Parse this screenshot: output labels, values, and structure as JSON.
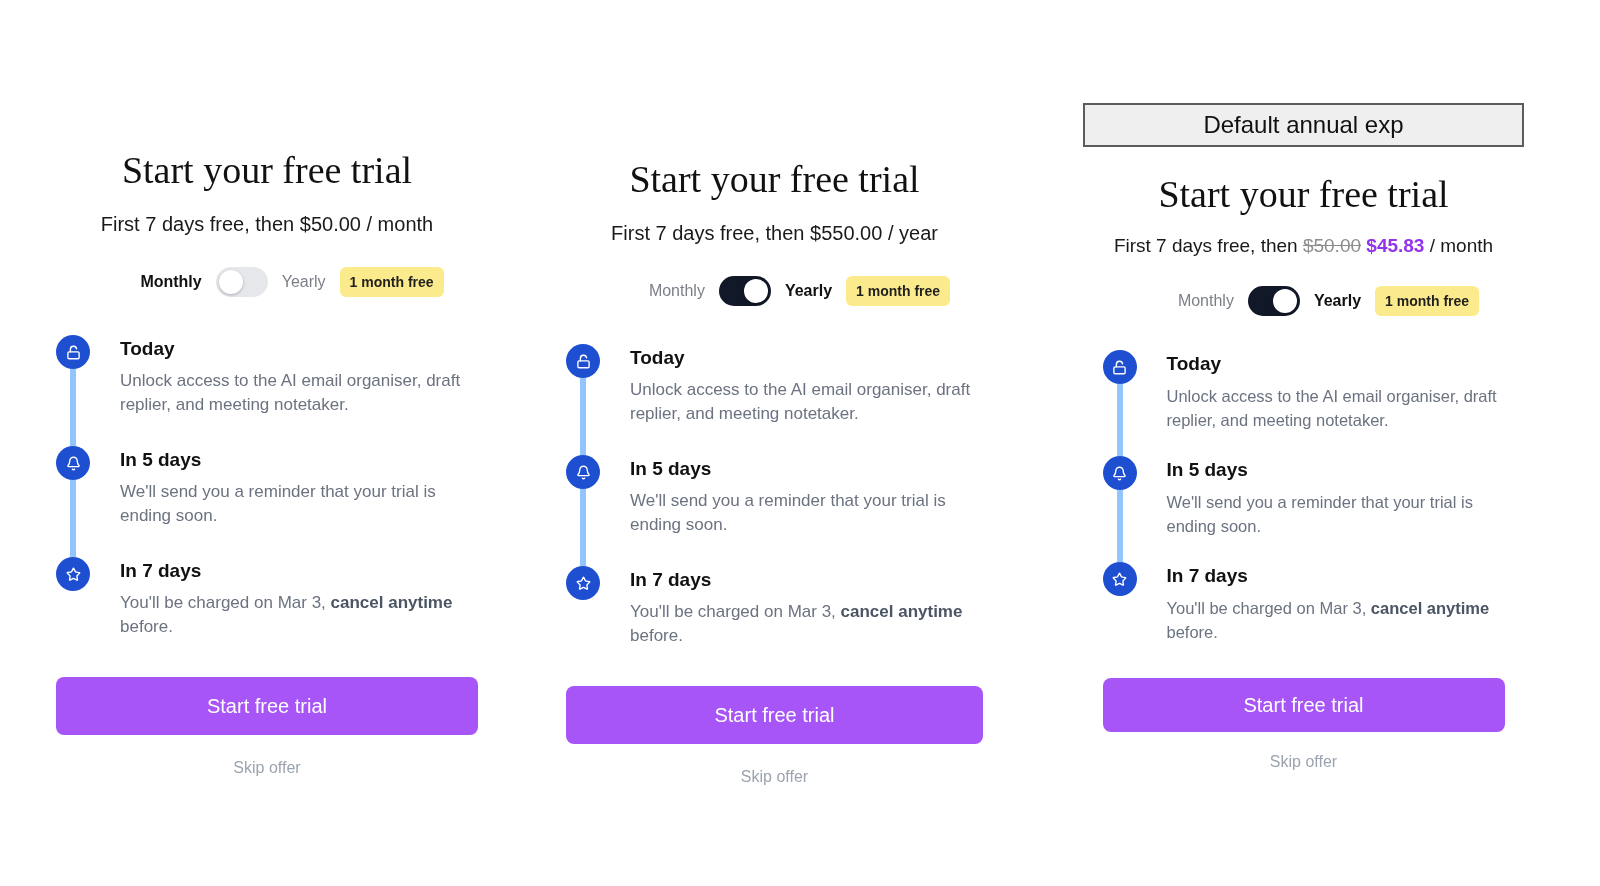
{
  "panels": [
    {
      "title": "Start your free trial",
      "offer": {
        "lead": "First 7 days free, then",
        "price": "$50.00",
        "period": "/ month"
      },
      "billing": {
        "options": [
          {
            "label": "Monthly",
            "selected": true
          },
          {
            "label": "Yearly",
            "selected": false
          }
        ],
        "switch_on": false,
        "badge": "1 month free"
      },
      "steps": [
        {
          "title": "Today",
          "text": "Unlock access to the AI email organiser, draft replier, and meeting notetaker."
        },
        {
          "title": "In 5 days",
          "text": "We'll send you a reminder that your trial is ending soon."
        },
        {
          "title": "In 7 days",
          "text": "You'll be charged on Mar 3, **cancel anytime** before."
        }
      ],
      "cta": "Start free trial",
      "skip": "Skip offer"
    },
    {
      "title": "Start your free trial",
      "offer": {
        "lead": "First 7 days free, then",
        "price": "$550.00",
        "period": "/ year"
      },
      "billing": {
        "options": [
          {
            "label": "Monthly",
            "selected": false
          },
          {
            "label": "Yearly",
            "selected": true
          }
        ],
        "switch_on": true,
        "badge": "1 month free"
      },
      "steps": [
        {
          "title": "Today",
          "text": "Unlock access to the AI email organiser, draft replier, and meeting notetaker."
        },
        {
          "title": "In 5 days",
          "text": "We'll send you a reminder that your trial is ending soon."
        },
        {
          "title": "In 7 days",
          "text": "You'll be charged on Mar 3, **cancel anytime** before."
        }
      ],
      "cta": "Start free trial",
      "skip": "Skip offer"
    },
    {
      "banner": "Default annual exp",
      "title": "Start your free trial",
      "offer": {
        "lead": "First 7 days free, then",
        "old_price": "$50.00",
        "price": "$45.83",
        "period": "/ month"
      },
      "billing": {
        "options": [
          {
            "label": "Monthly",
            "selected": false
          },
          {
            "label": "Yearly",
            "selected": true
          }
        ],
        "switch_on": true,
        "badge": "1 month free"
      },
      "steps": [
        {
          "title": "Today",
          "text": "Unlock access to the AI email organiser, draft replier, and meeting notetaker."
        },
        {
          "title": "In 5 days",
          "text": "We'll send you a reminder that your trial is ending soon."
        },
        {
          "title": "In 7 days",
          "text": "You'll be charged on Mar 3, **cancel anytime** before."
        }
      ],
      "cta": "Start free trial",
      "skip": "Skip offer"
    }
  ]
}
